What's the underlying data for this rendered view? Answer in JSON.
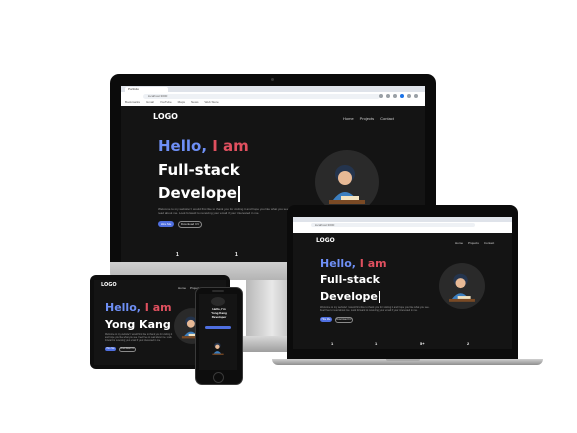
{
  "site": {
    "logo": "LOGO",
    "nav": [
      "Home",
      "Projects",
      "Contact"
    ],
    "hello_a": "Hello,",
    "hello_b": "I am",
    "role_line1": "Full-stack",
    "role_line2": "Develope",
    "name": "Yong Kang",
    "blurb": "Welcome to my website! I would first like to thank you for visiting it and hope you like what you see. Feel free to read about me. Look forward to receiving your email if your interested in me.",
    "btn_primary": "Hire Me",
    "btn_secondary": "Download CV",
    "stats_monitor": [
      "1",
      "1"
    ],
    "stats_laptop": [
      "1",
      "1",
      "5+",
      "2"
    ],
    "phone_title": "Hello, I'm",
    "phone_sub1": "Yong Kang",
    "phone_sub2": "Developer"
  },
  "browser": {
    "tab": "Portfolio",
    "url": "localhost:3000",
    "bookmarks": [
      "Bookmarks",
      "Gmail",
      "YouTube",
      "Maps",
      "News",
      "Web Store"
    ]
  },
  "colors": {
    "bg": "#141414",
    "accent_blue": "#6e8ff5",
    "accent_red": "#e0505f",
    "button": "#4f6fe0"
  }
}
